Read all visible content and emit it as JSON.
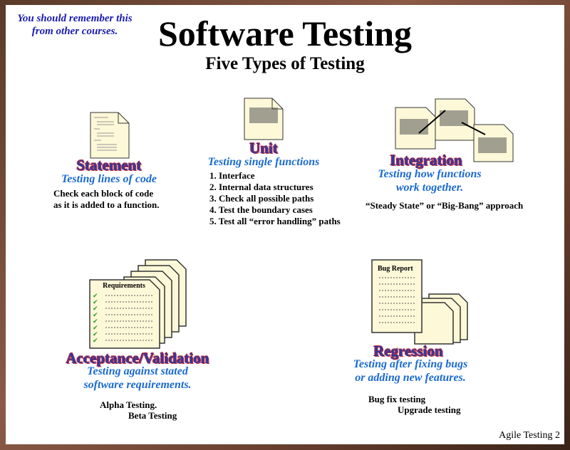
{
  "note": "You should remember this from other courses.",
  "title": "Software Testing",
  "subtitle": "Five Types of Testing",
  "statement": {
    "heading": "Statement",
    "subheading": "Testing lines of code",
    "lines": [
      "Check each block of code",
      "as it is added to a function."
    ]
  },
  "unit": {
    "heading": "Unit",
    "subheading": "Testing single functions",
    "items": [
      "1. Interface",
      "2. Internal data structures",
      "3. Check all possible paths",
      "4. Test the boundary cases",
      "5. Test all “error handling” paths"
    ]
  },
  "integration": {
    "heading": "Integration",
    "subheading_1": "Testing how functions",
    "subheading_2": "work together.",
    "note": "“Steady State” or “Big-Bang” approach"
  },
  "acceptance": {
    "heading": "Acceptance/Validation",
    "subheading_1": "Testing against stated",
    "subheading_2": "software requirements.",
    "line_1": "Alpha Testing.",
    "line_2": "Beta Testing",
    "doc_title": "Requirements"
  },
  "regression": {
    "heading": "Regression",
    "subheading_1": "Testing after fixing bugs",
    "subheading_2": "or adding new features.",
    "line_1": "Bug fix testing",
    "line_2": "Upgrade testing",
    "doc_title": "Bug Report"
  },
  "footer": "Agile Testing 2"
}
